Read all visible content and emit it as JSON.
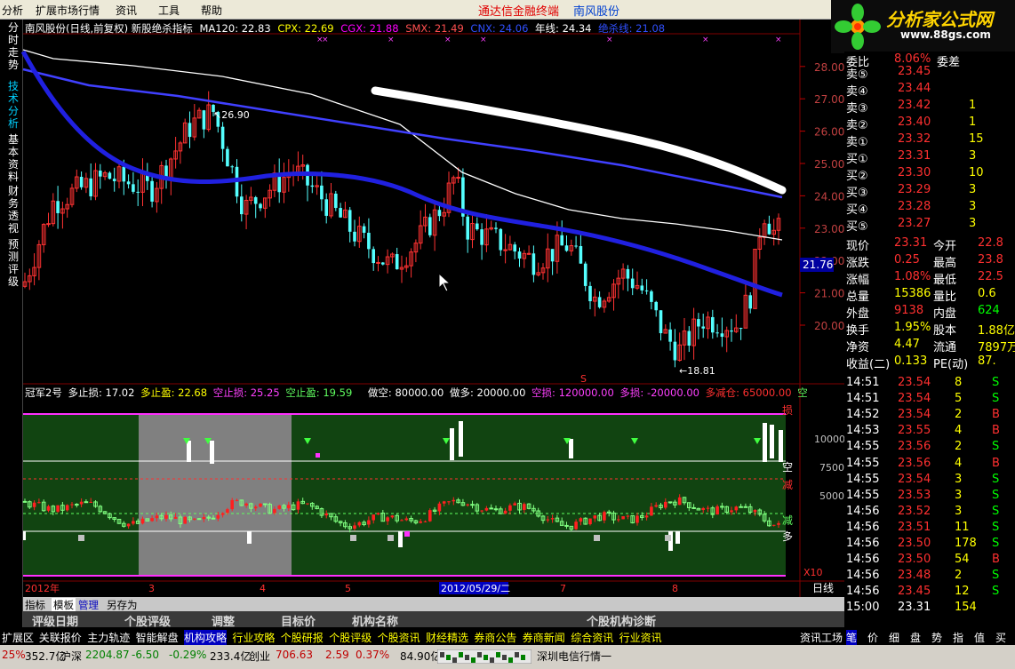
{
  "menu": {
    "items": [
      "分析",
      "扩展市场行情",
      "资讯",
      "工具",
      "帮助"
    ],
    "app_title": "通达信金融终端",
    "stock_name": "南风股份"
  },
  "logo": {
    "text": "分析家公式网",
    "url": "www.88gs.com"
  },
  "left_tabs": [
    "分时走势",
    "技术分析",
    "基本资料",
    "财务透视",
    "预测评级"
  ],
  "main_header": [
    {
      "text": "南风股份(日线,前复权) 新股绝杀指标",
      "color": "#ffffff"
    },
    {
      "text": "MA120: 22.83",
      "color": "#ffffff"
    },
    {
      "text": "CPX: 22.69",
      "color": "#ffff00"
    },
    {
      "text": "CGX: 21.88",
      "color": "#ff00ff"
    },
    {
      "text": "SMX: 21.49",
      "color": "#ff5050"
    },
    {
      "text": "CNX: 24.06",
      "color": "#3050ff"
    },
    {
      "text": "年线: 24.34",
      "color": "#ffffff"
    },
    {
      "text": "绝杀线: 21.08",
      "color": "#3050ff"
    }
  ],
  "price_axis": [
    "28.00",
    "27.00",
    "26.00",
    "25.00",
    "24.00",
    "23.00",
    "22.00",
    "21.00",
    "20.00"
  ],
  "price_current_label": "21.76",
  "annotations": {
    "high": "26.90",
    "low": "18.81"
  },
  "ind_header": [
    {
      "text": "冠军2号",
      "color": "#ffffff"
    },
    {
      "text": "多止损: 17.02",
      "color": "#ffffff"
    },
    {
      "text": "多止盈: 22.68",
      "color": "#ffff00"
    },
    {
      "text": "空止损: 25.25",
      "color": "#ff40ff"
    },
    {
      "text": "空止盈: 19.59",
      "color": "#60ff60"
    },
    {
      "text": "做空: 80000.00",
      "color": "#ffffff"
    },
    {
      "text": "做多: 20000.00",
      "color": "#ffffff"
    },
    {
      "text": "空损: 120000.00",
      "color": "#ff40ff"
    },
    {
      "text": "多损: -20000.00",
      "color": "#ff40ff"
    },
    {
      "text": "多减仓: 65000.00",
      "color": "#ff3030"
    },
    {
      "text": "空",
      "color": "#60ff60"
    }
  ],
  "ind_axis": [
    "10000",
    "7500",
    "5000"
  ],
  "ind_scale": "X10",
  "ind_labels": {
    "sun": "损",
    "kong": "空",
    "jian1": "减",
    "jian2": "减",
    "duo": "多"
  },
  "date_axis": {
    "year": "2012年",
    "months": [
      "3",
      "4",
      "5",
      "7",
      "8"
    ],
    "cursor_date": "2012/05/29/二"
  },
  "period": "日线",
  "bottom_tabs1": [
    "指标",
    "模板",
    "管理",
    "另存为"
  ],
  "bottom_tabs2": [
    "评级日期",
    "个股评级",
    "调整",
    "目标价",
    "机构名称",
    "个股机构诊断"
  ],
  "order_book": {
    "header": {
      "left": "委比",
      "val": "8.06%",
      "mid": "委差"
    },
    "sell": [
      [
        "卖⑤",
        "23.45",
        ""
      ],
      [
        "卖④",
        "23.44",
        ""
      ],
      [
        "卖③",
        "23.42",
        "1"
      ],
      [
        "卖②",
        "23.40",
        "1"
      ],
      [
        "卖①",
        "23.32",
        "15"
      ]
    ],
    "buy": [
      [
        "买①",
        "23.31",
        "3"
      ],
      [
        "买②",
        "23.30",
        "10"
      ],
      [
        "买③",
        "23.29",
        "3"
      ],
      [
        "买④",
        "23.28",
        "3"
      ],
      [
        "买⑤",
        "23.27",
        "3"
      ]
    ]
  },
  "quote": [
    [
      "现价",
      "23.31",
      "今开",
      "22.8"
    ],
    [
      "涨跌",
      "0.25",
      "最高",
      "23.8"
    ],
    [
      "涨幅",
      "1.08%",
      "最低",
      "22.5"
    ],
    [
      "总量",
      "15386",
      "量比",
      "0.6"
    ],
    [
      "外盘",
      "9138",
      "内盘",
      "624"
    ],
    [
      "换手",
      "1.95%",
      "股本",
      "1.88亿"
    ],
    [
      "净资",
      "4.47",
      "流通",
      "7897万"
    ],
    [
      "收益(二)",
      "0.133",
      "PE(动)",
      "87."
    ]
  ],
  "ticks": [
    [
      "14:51",
      "23.54",
      "8",
      "S"
    ],
    [
      "14:51",
      "23.54",
      "5",
      "S"
    ],
    [
      "14:52",
      "23.54",
      "2",
      "B"
    ],
    [
      "14:53",
      "23.55",
      "4",
      "B"
    ],
    [
      "14:55",
      "23.56",
      "2",
      "S"
    ],
    [
      "14:55",
      "23.56",
      "4",
      "B"
    ],
    [
      "14:55",
      "23.54",
      "3",
      "S"
    ],
    [
      "14:55",
      "23.53",
      "3",
      "S"
    ],
    [
      "14:56",
      "23.52",
      "3",
      "S"
    ],
    [
      "14:56",
      "23.51",
      "11",
      "S"
    ],
    [
      "14:56",
      "23.50",
      "178",
      "S"
    ],
    [
      "14:56",
      "23.50",
      "54",
      "B"
    ],
    [
      "14:56",
      "23.48",
      "2",
      "S"
    ],
    [
      "14:56",
      "23.45",
      "12",
      "S"
    ],
    [
      "15:00",
      "23.31",
      "154",
      ""
    ]
  ],
  "bottom_tabs3": [
    "扩展区",
    "关联报价",
    "主力轨迹",
    "智能解盘",
    "机构攻略",
    "行业攻略",
    "个股研报",
    "个股评级",
    "个股资讯",
    "财经精选",
    "券商公告",
    "券商新闻",
    "综合资讯",
    "行业资讯"
  ],
  "right_tabs3": [
    "资讯工场",
    "笔",
    "价",
    "细",
    "盘",
    "势",
    "指",
    "值",
    "买"
  ],
  "status": {
    "s1": "25%",
    "s2": "352.7亿",
    "s3": "沪深",
    "s4": "2204.87",
    "s5": "-6.50",
    "s6": "-0.29%",
    "s7": "233.4亿",
    "s8": "创业",
    "s9": "706.63",
    "s10": "2.59",
    "s11": "0.37%",
    "s12": "84.90亿",
    "s13": "深圳电信行情一"
  },
  "colors": {
    "up": "#ff3232",
    "down": "#54ffff",
    "ma": "#3232ff",
    "white_line": "#ffffff",
    "ind_bg": "#114411"
  }
}
